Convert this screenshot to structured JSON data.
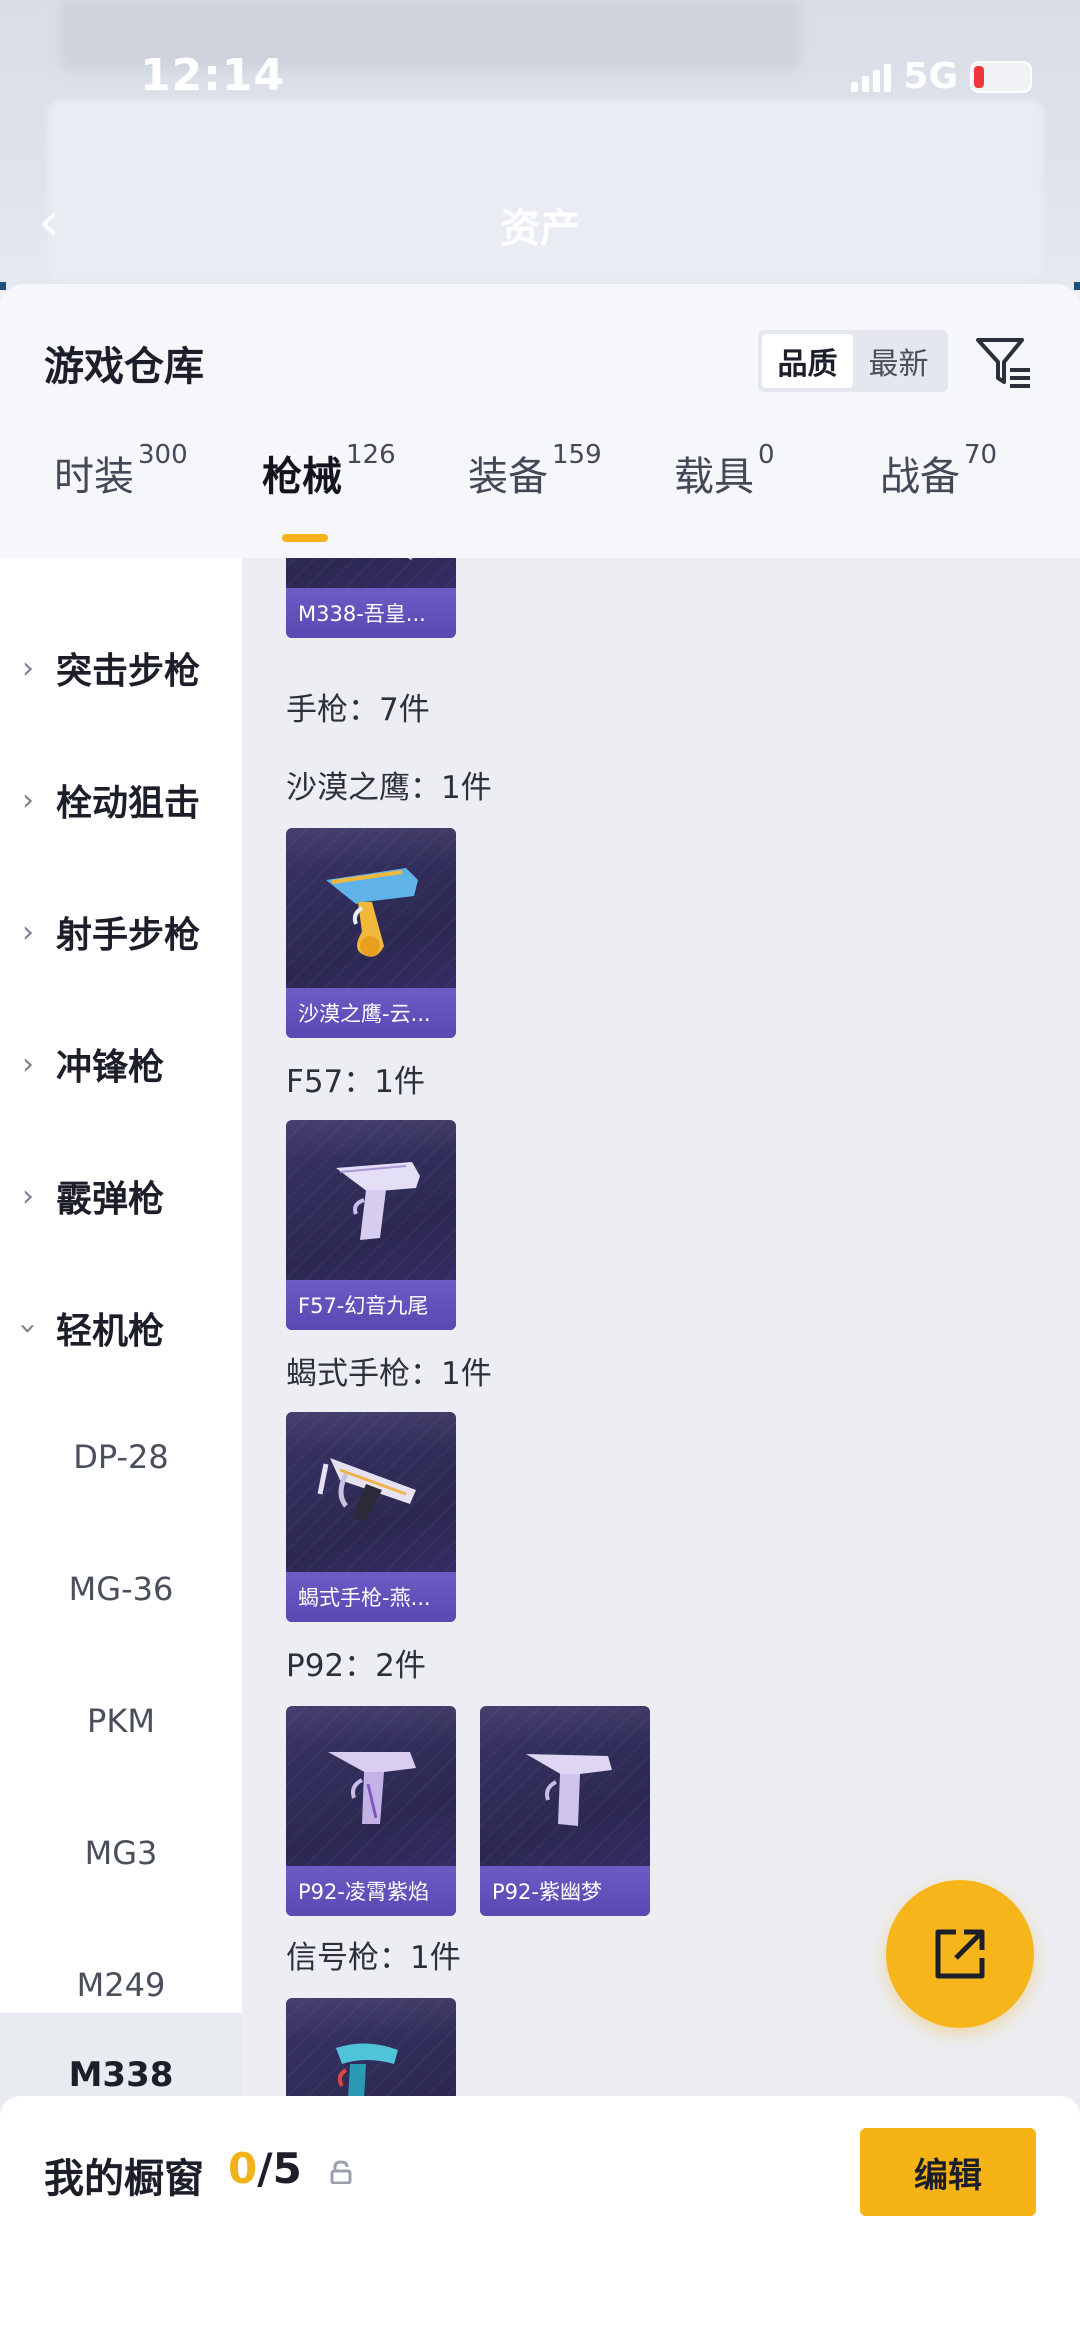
{
  "status_bar": {
    "time": "12:14",
    "network": "5G"
  },
  "nav": {
    "title": "资产"
  },
  "sheet": {
    "title": "游戏仓库"
  },
  "sort": {
    "options": [
      "品质",
      "最新"
    ],
    "selected": "品质"
  },
  "tabs": [
    {
      "label": "时装",
      "count": "300"
    },
    {
      "label": "枪械",
      "count": "126"
    },
    {
      "label": "装备",
      "count": "159"
    },
    {
      "label": "载具",
      "count": "0"
    },
    {
      "label": "战备",
      "count": "70"
    }
  ],
  "active_tab": "枪械",
  "categories": [
    {
      "label": "突击步枪",
      "expanded": false
    },
    {
      "label": "栓动狙击",
      "expanded": false
    },
    {
      "label": "射手步枪",
      "expanded": false
    },
    {
      "label": "冲锋枪",
      "expanded": false
    },
    {
      "label": "霰弹枪",
      "expanded": false
    },
    {
      "label": "轻机枪",
      "expanded": true
    }
  ],
  "subcategories": [
    "DP-28",
    "MG-36",
    "PKM",
    "MG3",
    "M249"
  ],
  "selected_subcategory": "M338",
  "items": {
    "top_card": "M338-吾皇...",
    "section_pistol": "手枪：7件",
    "groups": [
      {
        "label": "沙漠之鹰：1件",
        "cards": [
          "沙漠之鹰-云..."
        ]
      },
      {
        "label": "F57：1件",
        "cards": [
          "F57-幻音九尾"
        ]
      },
      {
        "label": "蝎式手枪：1件",
        "cards": [
          "蝎式手枪-燕..."
        ]
      },
      {
        "label": "P92：2件",
        "cards": [
          "P92-凌霄紫焰",
          "P92-紫幽梦"
        ]
      },
      {
        "label": "信号枪：1件",
        "cards": [
          ""
        ]
      }
    ]
  },
  "showcase": {
    "title": "我的橱窗",
    "current": "0",
    "separator": "/",
    "max": "5",
    "edit_label": "编辑"
  },
  "colors": {
    "accent": "#f5b316",
    "card_bg": "#2b2852",
    "card_caption": "#5a48b3"
  }
}
